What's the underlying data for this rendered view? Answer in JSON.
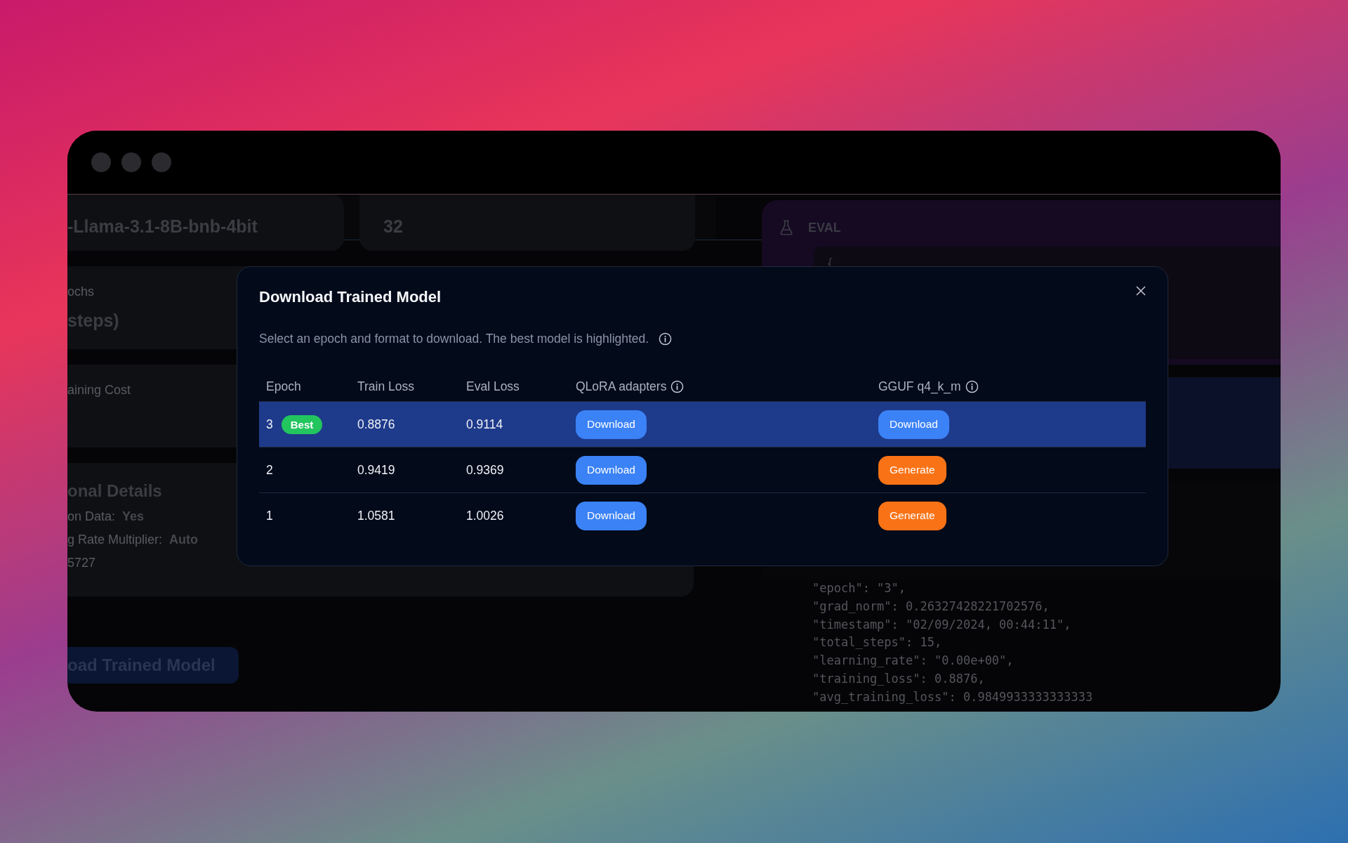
{
  "background_page": {
    "left": {
      "base_model_value": "-Llama-3.1-8B-bnb-4bit",
      "batch_size_value": "32",
      "epochs_label": "ochs",
      "epochs_value": "steps)",
      "cost_label": "aining Cost",
      "details_title": "onal Details",
      "details": [
        {
          "label": "on Data:",
          "value": "Yes"
        },
        {
          "label": "g Rate Multiplier:",
          "value": "Auto"
        },
        {
          "label": "5727"
        }
      ],
      "download_button": "oad Trained Model"
    },
    "right": {
      "eval_title": "EVAL",
      "eval_code": "{",
      "log_lines": [
        "\"epoch\": \"3\",",
        "\"grad_norm\": 0.26327428221702576,",
        "\"timestamp\": \"02/09/2024, 00:44:11\",",
        "\"total_steps\": 15,",
        "\"learning_rate\": \"0.00e+00\",",
        "\"training_loss\": 0.8876,",
        "\"avg_training_loss\": 0.9849933333333333"
      ]
    }
  },
  "dialog": {
    "title": "Download Trained Model",
    "description": "Select an epoch and format to download. The best model is highlighted.",
    "columns": [
      {
        "label": "Epoch"
      },
      {
        "label": "Train Loss"
      },
      {
        "label": "Eval Loss"
      },
      {
        "label": "QLoRA adapters",
        "info": true
      },
      {
        "label": "GGUF q4_k_m",
        "info": true
      }
    ],
    "rows": [
      {
        "epoch": "3",
        "badge": "Best",
        "selected": true,
        "train_loss": "0.8876",
        "eval_loss": "0.9114",
        "qlora": {
          "label": "Download",
          "kind": "download"
        },
        "gguf": {
          "label": "Download",
          "kind": "download"
        }
      },
      {
        "epoch": "2",
        "selected": false,
        "train_loss": "0.9419",
        "eval_loss": "0.9369",
        "qlora": {
          "label": "Download",
          "kind": "download"
        },
        "gguf": {
          "label": "Generate",
          "kind": "generate"
        }
      },
      {
        "epoch": "1",
        "selected": false,
        "train_loss": "1.0581",
        "eval_loss": "1.0026",
        "qlora": {
          "label": "Download",
          "kind": "download"
        },
        "gguf": {
          "label": "Generate",
          "kind": "generate"
        }
      }
    ]
  }
}
